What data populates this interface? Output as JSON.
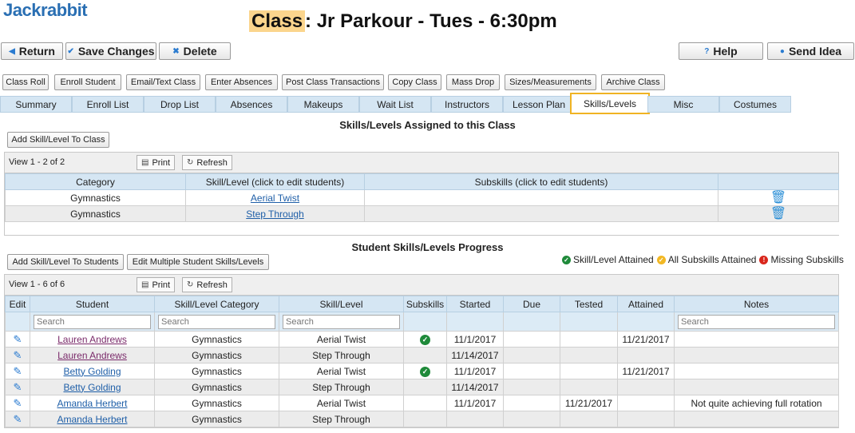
{
  "app": {
    "logo": "Jackrabbit"
  },
  "page": {
    "title_prefix": "Class",
    "title_rest": ": Jr Parkour - Tues - 6:30pm"
  },
  "top_buttons": {
    "return": "Return",
    "save": "Save Changes",
    "delete": "Delete",
    "help": "Help",
    "send_idea": "Send Idea"
  },
  "action_buttons": [
    "Class Roll",
    "Enroll Student",
    "Email/Text Class",
    "Enter Absences",
    "Post Class Transactions",
    "Copy Class",
    "Mass Drop",
    "Sizes/Measurements",
    "Archive Class"
  ],
  "tabs": [
    "Summary",
    "Enroll List",
    "Drop List",
    "Absences",
    "Makeups",
    "Wait List",
    "Instructors",
    "Lesson Plan",
    "Skills/Levels",
    "Misc",
    "Costumes"
  ],
  "active_tab": "Skills/Levels",
  "assigned": {
    "title": "Skills/Levels Assigned to this Class",
    "add_button": "Add Skill/Level To Class",
    "view_info": "View 1 - 2 of 2",
    "print": "Print",
    "refresh": "Refresh",
    "columns": [
      "Category",
      "Skill/Level (click to edit students)",
      "Subskills (click to edit students)",
      ""
    ],
    "rows": [
      {
        "category": "Gymnastics",
        "skill": "Aerial Twist",
        "subskills": ""
      },
      {
        "category": "Gymnastics",
        "skill": "Step Through",
        "subskills": ""
      }
    ]
  },
  "progress": {
    "title": "Student Skills/Levels Progress",
    "add_button": "Add Skill/Level To Students",
    "edit_multiple_button": "Edit Multiple Student Skills/Levels",
    "legend": {
      "attained": "Skill/Level Attained",
      "all_subskills": "All Subskills Attained",
      "missing": "Missing Subskills"
    },
    "view_info": "View 1 - 6 of 6",
    "print": "Print",
    "refresh": "Refresh",
    "columns": [
      "Edit",
      "Student",
      "Skill/Level Category",
      "Skill/Level",
      "Subskills",
      "Started",
      "Due",
      "Tested",
      "Attained",
      "Notes"
    ],
    "search_placeholder": "Search",
    "rows": [
      {
        "student": "Lauren Andrews",
        "category": "Gymnastics",
        "skill": "Aerial Twist",
        "subskills_done": true,
        "started": "11/1/2017",
        "due": "",
        "tested": "",
        "attained": "11/21/2017",
        "notes": ""
      },
      {
        "student": "Lauren Andrews",
        "category": "Gymnastics",
        "skill": "Step Through",
        "subskills_done": false,
        "started": "11/14/2017",
        "due": "",
        "tested": "",
        "attained": "",
        "notes": ""
      },
      {
        "student": "Betty Golding",
        "category": "Gymnastics",
        "skill": "Aerial Twist",
        "subskills_done": true,
        "started": "11/1/2017",
        "due": "",
        "tested": "",
        "attained": "11/21/2017",
        "notes": ""
      },
      {
        "student": "Betty Golding",
        "category": "Gymnastics",
        "skill": "Step Through",
        "subskills_done": false,
        "started": "11/14/2017",
        "due": "",
        "tested": "",
        "attained": "",
        "notes": ""
      },
      {
        "student": "Amanda Herbert",
        "category": "Gymnastics",
        "skill": "Aerial Twist",
        "subskills_done": false,
        "started": "11/1/2017",
        "due": "",
        "tested": "11/21/2017",
        "attained": "",
        "notes": "Not quite achieving full rotation"
      },
      {
        "student": "Amanda Herbert",
        "category": "Gymnastics",
        "skill": "Step Through",
        "subskills_done": false,
        "started": "",
        "due": "",
        "tested": "",
        "attained": "",
        "notes": ""
      }
    ]
  },
  "colors": {
    "brand": "#2a6fb3",
    "title_highlight": "#fbd58d",
    "tab_active_border": "#f0b323",
    "header_bg": "#d5e6f3",
    "check_green": "#1f8a3a",
    "warn_yellow": "#f2b824",
    "error_red": "#d9261c"
  }
}
